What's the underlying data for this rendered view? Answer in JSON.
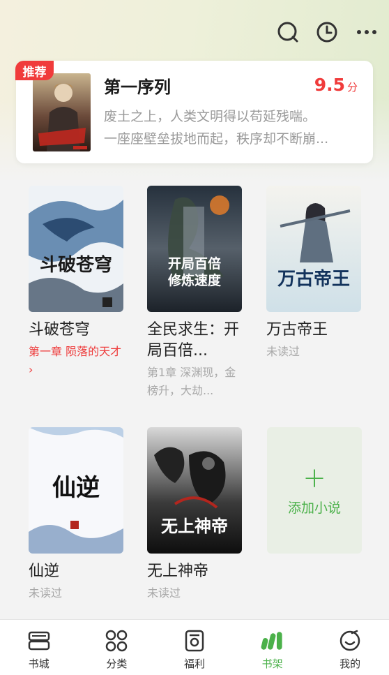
{
  "topbar": {
    "icons": [
      "search-icon",
      "history-icon",
      "more-icon"
    ]
  },
  "featured": {
    "badge": "推荐",
    "title": "第一序列",
    "score": "9.5",
    "score_unit": "分",
    "desc_line1": "废土之上，人类文明得以苟延残喘。",
    "desc_line2": "一座座壁垒拔地而起，秩序却不断崩..."
  },
  "books": [
    {
      "title": "斗破苍穹",
      "sub": "第一章 陨落的天才 ›"
    },
    {
      "title": "全民求生：开局百倍...",
      "sub": "第1章 深渊现，金榜升，大劫..."
    },
    {
      "title": "万古帝王",
      "sub": "未读过"
    },
    {
      "title": "仙逆",
      "sub": "未读过"
    },
    {
      "title": "无上神帝",
      "sub": "未读过"
    }
  ],
  "add_card": {
    "plus": "+",
    "label": "添加小说"
  },
  "nav": [
    {
      "label": "书城",
      "icon": "bookstore-icon"
    },
    {
      "label": "分类",
      "icon": "category-icon"
    },
    {
      "label": "福利",
      "icon": "welfare-icon"
    },
    {
      "label": "书架",
      "icon": "bookshelf-icon"
    },
    {
      "label": "我的",
      "icon": "profile-icon"
    }
  ],
  "colors": {
    "accent": "#4bb14a",
    "red": "#f03b3b"
  }
}
